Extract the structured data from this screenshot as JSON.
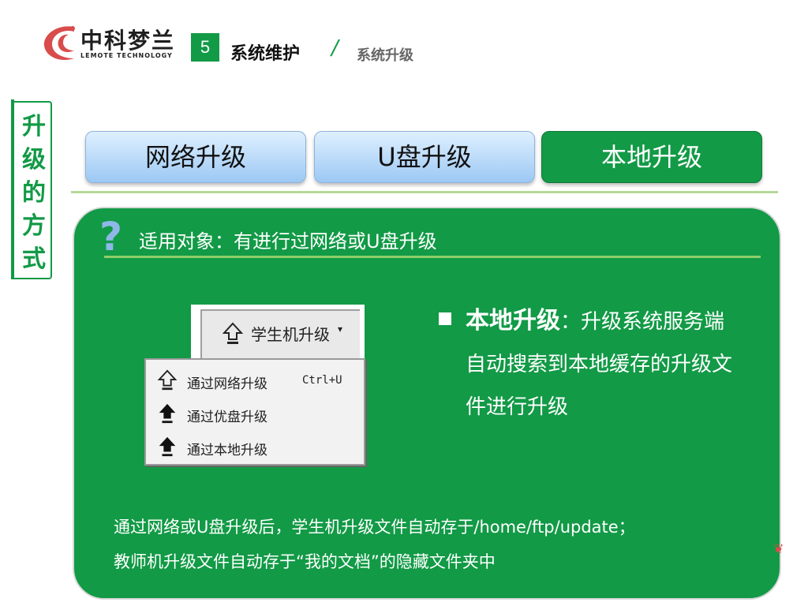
{
  "header": {
    "logo_name": "中科梦兰",
    "logo_sub": "LEMOTE TECHNOLOGY",
    "section_number": "5",
    "section_title": "系统维护",
    "section_separator": "/",
    "section_subtitle": "系统升级"
  },
  "side_tag": {
    "text": "升级的方式"
  },
  "tabs": [
    {
      "label": "网络升级",
      "active": false
    },
    {
      "label": "U盘升级",
      "active": false
    },
    {
      "label": "本地升级",
      "active": true
    }
  ],
  "panel": {
    "title": "适用对象：有进行过网络或U盘升级",
    "bullet_heading": "本地升级",
    "bullet_body": "：升级系统服务端自动搜索到本地缓存的升级文件进行升级",
    "note_line1": "通过网络或U盘升级后，学生机升级文件自动存于/home/ftp/update；",
    "note_line2": "教师机升级文件自动存于“我的文档”的隐藏文件夹中"
  },
  "menu": {
    "button_label": "学生机升级",
    "items": [
      {
        "label": "通过网络升级",
        "shortcut": "Ctrl+U",
        "icon": "upload-outline-icon"
      },
      {
        "label": "通过优盘升级",
        "shortcut": "",
        "icon": "upload-filled-icon"
      },
      {
        "label": "通过本地升级",
        "shortcut": "",
        "icon": "upload-filled-icon"
      }
    ]
  },
  "colors": {
    "brand_green": "#129a46",
    "tab_blue": "#9cc8f4",
    "logo_red": "#d94c4c"
  }
}
